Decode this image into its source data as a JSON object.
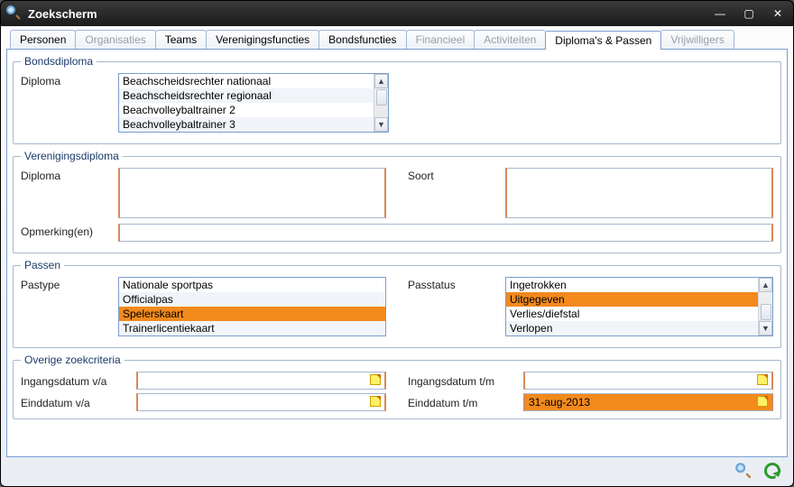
{
  "window": {
    "title": "Zoekscherm"
  },
  "tabs": [
    {
      "label": "Personen",
      "enabled": true,
      "active": false
    },
    {
      "label": "Organisaties",
      "enabled": false,
      "active": false
    },
    {
      "label": "Teams",
      "enabled": true,
      "active": false
    },
    {
      "label": "Verenigingsfuncties",
      "enabled": true,
      "active": false
    },
    {
      "label": "Bondsfuncties",
      "enabled": true,
      "active": false
    },
    {
      "label": "Financieel",
      "enabled": false,
      "active": false
    },
    {
      "label": "Activiteiten",
      "enabled": false,
      "active": false
    },
    {
      "label": "Diploma's & Passen",
      "enabled": true,
      "active": true
    },
    {
      "label": "Vrijwilligers",
      "enabled": false,
      "active": false
    }
  ],
  "bondsdiploma": {
    "legend": "Bondsdiploma",
    "label": "Diploma",
    "items": [
      "Beachscheidsrechter nationaal",
      "Beachscheidsrechter regionaal",
      "Beachvolleybaltrainer 2",
      "Beachvolleybaltrainer 3"
    ],
    "selected": null
  },
  "verenigingsdiploma": {
    "legend": "Verenigingsdiploma",
    "diploma_label": "Diploma",
    "soort_label": "Soort",
    "opmerking_label": "Opmerking(en)",
    "diploma_value": "",
    "soort_value": "",
    "opmerking_value": ""
  },
  "passen": {
    "legend": "Passen",
    "pastype_label": "Pastype",
    "passtatus_label": "Passtatus",
    "pastype_items": [
      "Nationale sportpas",
      "Officialpas",
      "Spelerskaart",
      "Trainerlicentiekaart"
    ],
    "pastype_selected": "Spelerskaart",
    "passtatus_items": [
      "Ingetrokken",
      "Uitgegeven",
      "Verlies/diefstal",
      "Verlopen"
    ],
    "passtatus_selected": "Uitgegeven"
  },
  "overige": {
    "legend": "Overige zoekcriteria",
    "ingang_va_label": "Ingangsdatum v/a",
    "eind_va_label": "Einddatum v/a",
    "ingang_tm_label": "Ingangsdatum t/m",
    "eind_tm_label": "Einddatum t/m",
    "ingang_va_value": "",
    "eind_va_value": "",
    "ingang_tm_value": "",
    "eind_tm_value": "31-aug-2013"
  }
}
